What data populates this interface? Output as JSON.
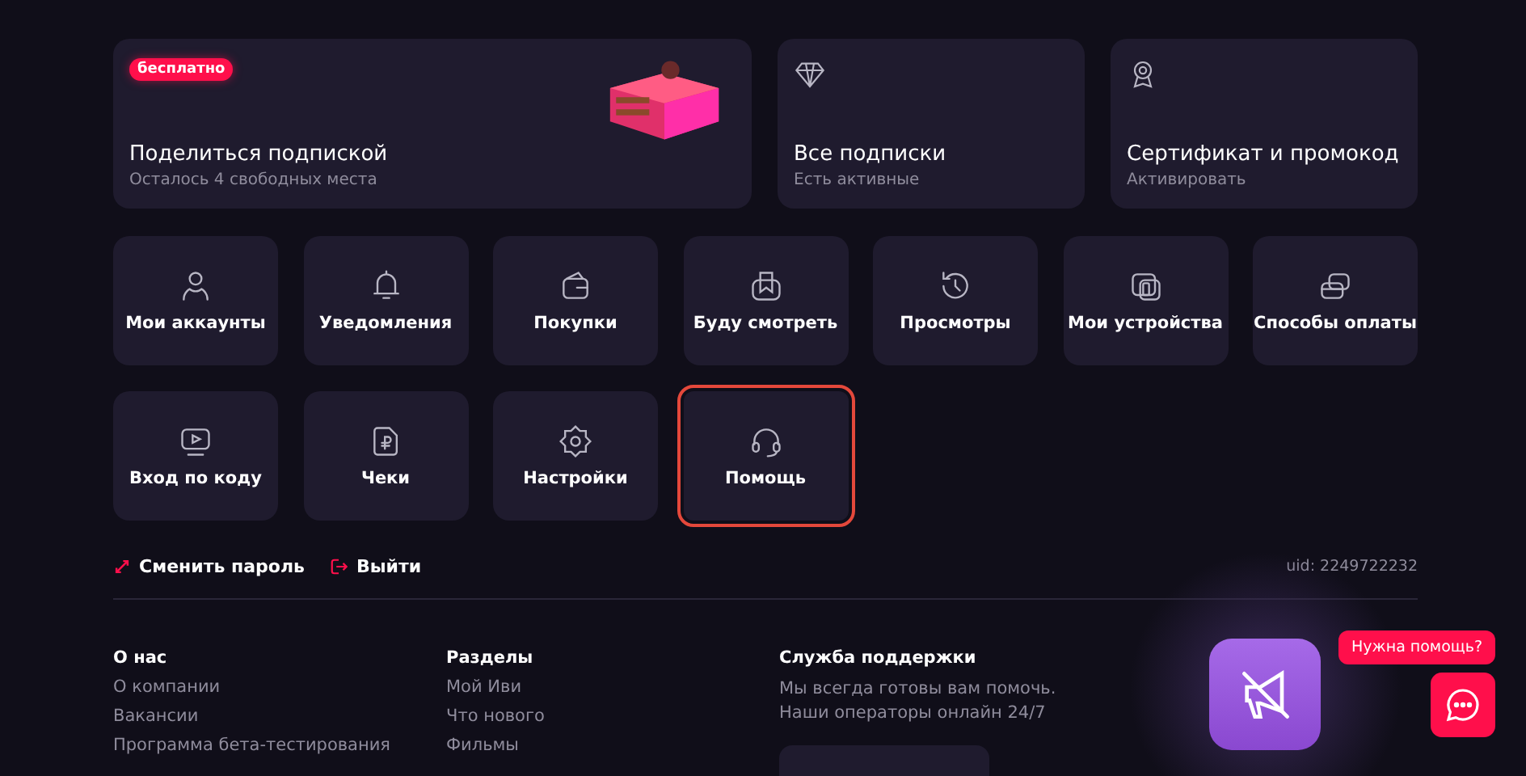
{
  "promo_cards": [
    {
      "badge": "бесплатно",
      "title": "Поделиться подпиской",
      "subtitle": "Осталось 4 свободных места"
    },
    {
      "title": "Все подписки",
      "subtitle": "Есть активные"
    },
    {
      "title": "Сертификат и промокод",
      "subtitle": "Активировать"
    }
  ],
  "tiles": [
    {
      "label": "Мои аккаунты",
      "highlighted": false
    },
    {
      "label": "Уведомления",
      "highlighted": false
    },
    {
      "label": "Покупки",
      "highlighted": false
    },
    {
      "label": "Буду смотреть",
      "highlighted": false
    },
    {
      "label": "Просмотры",
      "highlighted": false
    },
    {
      "label": "Мои устройства",
      "highlighted": false
    },
    {
      "label": "Способы оплаты",
      "highlighted": false
    },
    {
      "label": "Вход по коду",
      "highlighted": false
    },
    {
      "label": "Чеки",
      "highlighted": false
    },
    {
      "label": "Настройки",
      "highlighted": false
    },
    {
      "label": "Помощь",
      "highlighted": true
    }
  ],
  "account_links": [
    "Сменить пароль",
    "Выйти"
  ],
  "uid": "uid: 2249722232",
  "footer": {
    "columns": [
      {
        "heading": "О нас",
        "links": [
          "О компании",
          "Вакансии",
          "Программа бета-тестирования"
        ]
      },
      {
        "heading": "Разделы",
        "links": [
          "Мой Иви",
          "Что нового",
          "Фильмы"
        ]
      }
    ],
    "support": {
      "heading": "Служба поддержки",
      "text": [
        "Мы всегда готовы вам помочь.",
        "Наши операторы онлайн 24/7"
      ]
    }
  },
  "chat_widget": {
    "hint": "Нужна помощь?"
  }
}
